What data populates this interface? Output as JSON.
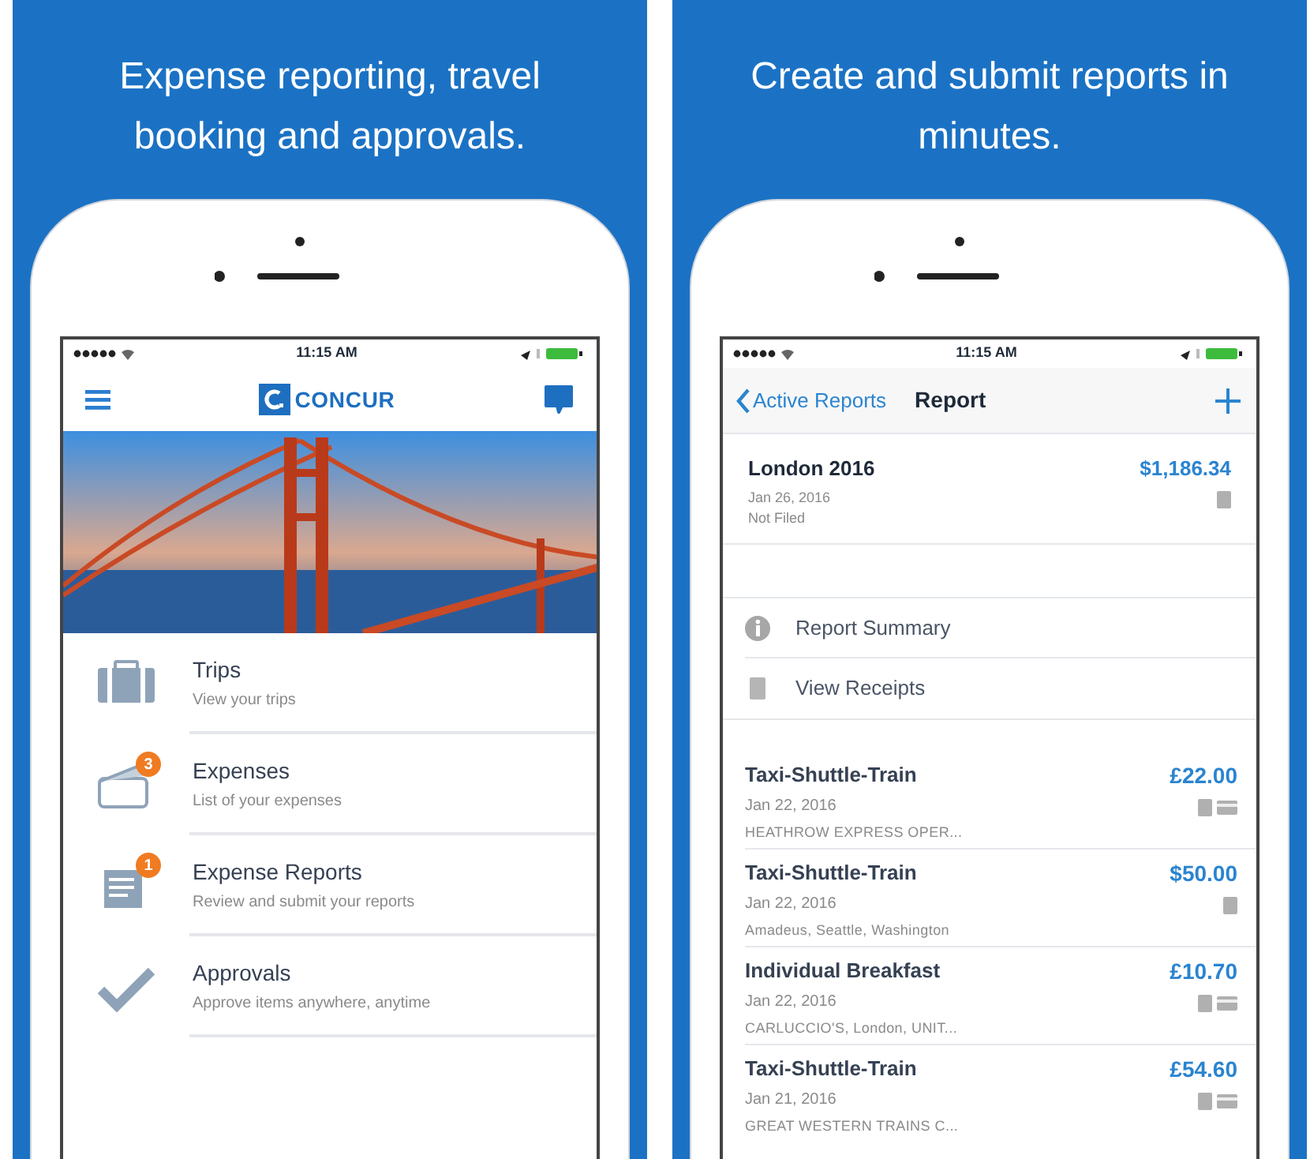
{
  "panels": [
    {
      "caption": "Expense reporting, travel booking and approvals.",
      "screen": {
        "kind": "home",
        "time": "11:15 AM",
        "logo": "CONCUR",
        "menu": [
          {
            "title": "Trips",
            "subtitle": "View your trips"
          },
          {
            "title": "Expenses",
            "subtitle": "List of your expenses",
            "badge": "3"
          },
          {
            "title": "Expense Reports",
            "subtitle": "Review and submit your reports",
            "badge": "1"
          },
          {
            "title": "Approvals",
            "subtitle": "Approve items anywhere, anytime"
          }
        ]
      }
    },
    {
      "caption": "Create and submit reports in minutes.",
      "screen": {
        "kind": "report",
        "time": "11:15 AM",
        "back": "Active Reports",
        "title": "Report",
        "report": {
          "name": "London 2016",
          "date": "Jan 26, 2016",
          "status": "Not Filed",
          "amount": "$1,186.34"
        },
        "actions": [
          "Report Summary",
          "View Receipts"
        ],
        "expenses": [
          {
            "type": "Taxi-Shuttle-Train",
            "date": "Jan 22, 2016",
            "vendor": "HEATHROW EXPRESS OPER...",
            "amount": "£22.00",
            "card": true
          },
          {
            "type": "Taxi-Shuttle-Train",
            "date": "Jan 22, 2016",
            "vendor": "Amadeus, Seattle, Washington",
            "amount": "$50.00",
            "card": false
          },
          {
            "type": "Individual Breakfast",
            "date": "Jan 22, 2016",
            "vendor": "CARLUCCIO'S, London, UNIT...",
            "amount": "£10.70",
            "card": true
          },
          {
            "type": "Taxi-Shuttle-Train",
            "date": "Jan 21, 2016",
            "vendor": "GREAT WESTERN TRAINS C...",
            "amount": "£54.60",
            "card": true
          }
        ]
      }
    }
  ]
}
